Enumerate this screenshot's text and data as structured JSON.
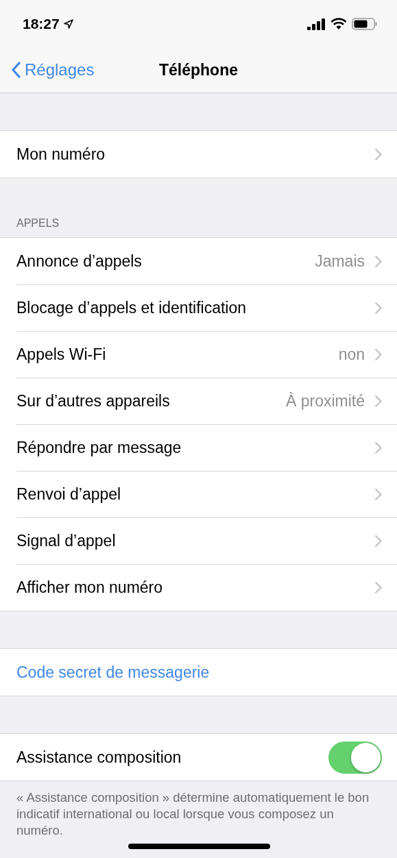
{
  "status_bar": {
    "time": "18:27"
  },
  "nav": {
    "back": "Réglages",
    "title": "Téléphone"
  },
  "sections": [
    {
      "rows": [
        {
          "kind": "nav",
          "label": "Mon numéro"
        }
      ]
    },
    {
      "header": "APPELS",
      "rows": [
        {
          "kind": "nav",
          "label": "Annonce d’appels",
          "value": "Jamais"
        },
        {
          "kind": "nav",
          "label": "Blocage d’appels et identification"
        },
        {
          "kind": "nav",
          "label": "Appels Wi-Fi",
          "value": "non"
        },
        {
          "kind": "nav",
          "label": "Sur d’autres appareils",
          "value": "À proximité"
        },
        {
          "kind": "nav",
          "label": "Répondre par message"
        },
        {
          "kind": "nav",
          "label": "Renvoi d’appel"
        },
        {
          "kind": "nav",
          "label": "Signal d’appel"
        },
        {
          "kind": "nav",
          "label": "Afficher mon numéro"
        }
      ]
    },
    {
      "rows": [
        {
          "kind": "action",
          "label": "Code secret de messagerie"
        }
      ]
    },
    {
      "rows": [
        {
          "kind": "toggle",
          "label": "Assistance composition",
          "on": true
        }
      ],
      "footer": "« Assistance composition » détermine automatiquement le bon indicatif international ou local lorsque vous composez un numéro."
    }
  ]
}
